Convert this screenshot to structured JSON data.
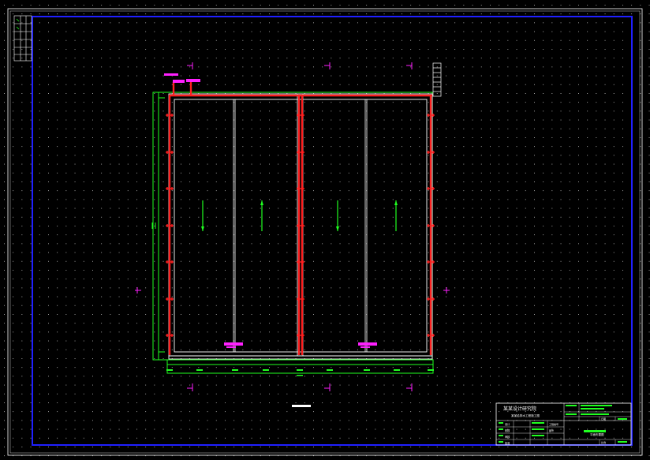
{
  "drawing": {
    "title_block": {
      "company": "某某设计研究院",
      "project": "某某给排水工程施工图",
      "drawing_name": "平面布置图",
      "rows_left": [
        "设计",
        "校核",
        "审核",
        "批准"
      ],
      "rows_mid": [
        "工程编号",
        "图号"
      ],
      "scale_label": "比例",
      "date_label": "日期"
    },
    "dimension_label": "",
    "colors": {
      "background": "#000000",
      "frame_blue": "#2020ff",
      "pipe_red": "#ff2020",
      "structure_green": "#20ff20",
      "annotation_magenta": "#ff20ff",
      "line_white": "#ffffff",
      "grid_dot": "#d0d0d0"
    },
    "icons": {
      "flow_arrow": "arrow-up-down-icon",
      "section_mark": "section-cut-icon",
      "stair": "ladder-icon"
    }
  }
}
